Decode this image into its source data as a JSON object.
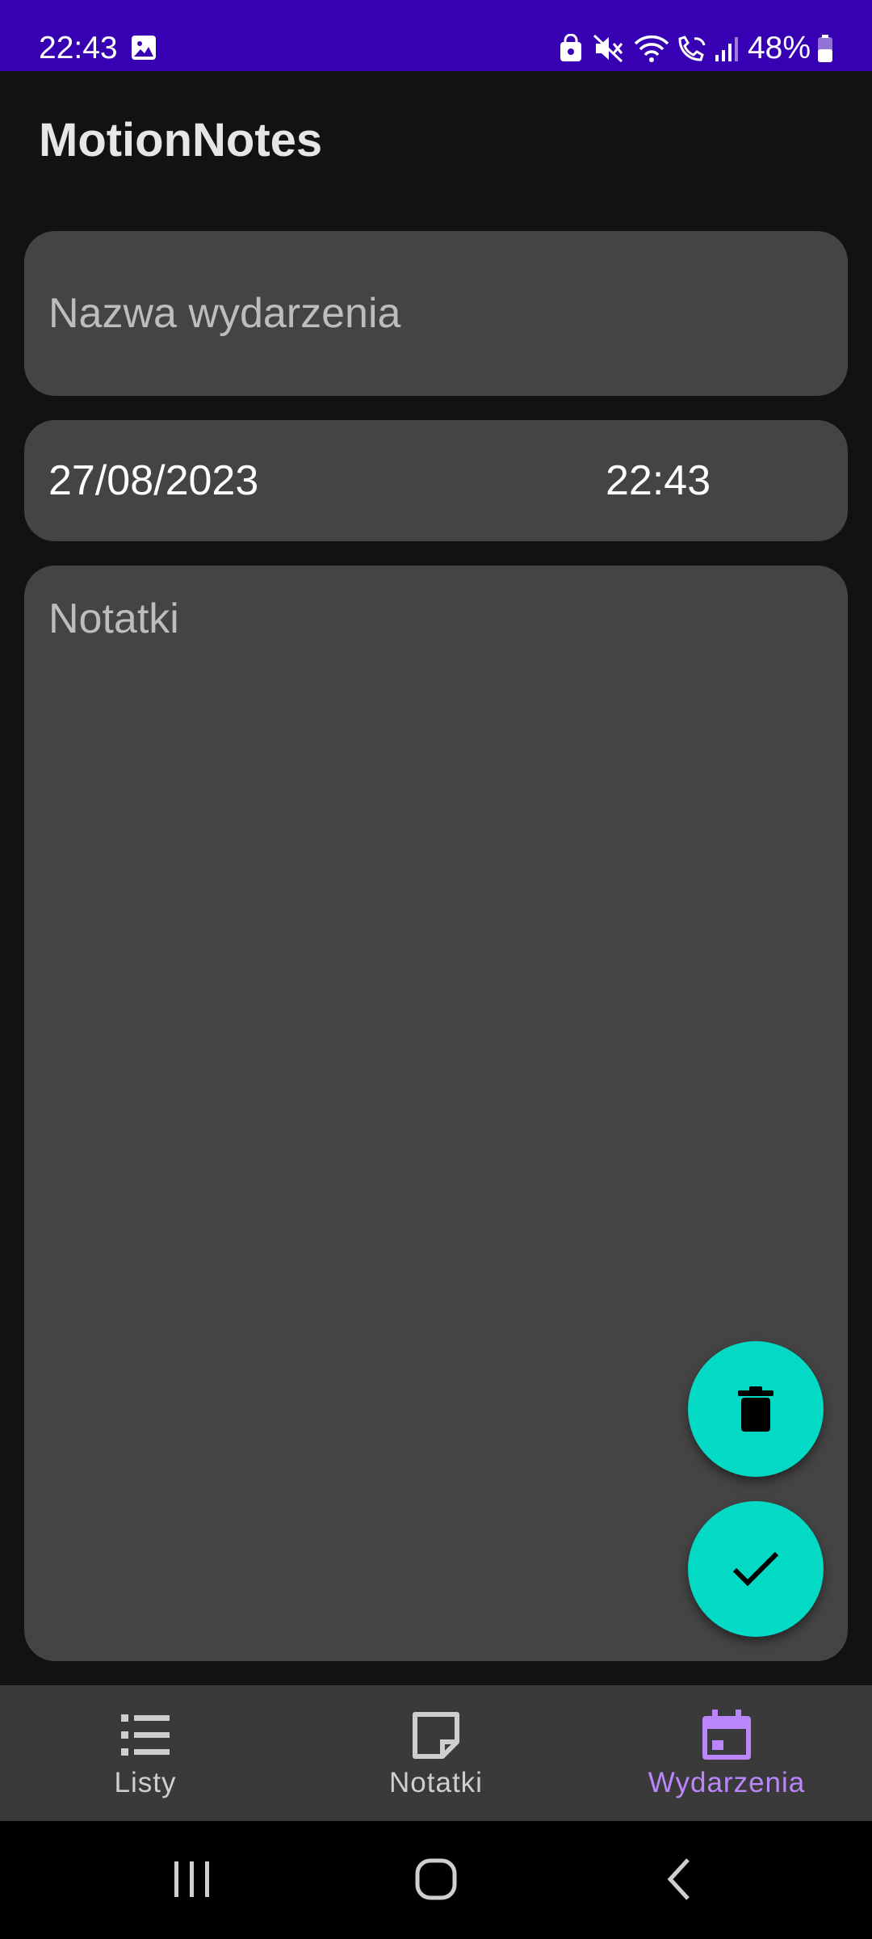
{
  "status_bar": {
    "time": "22:43",
    "battery": "48%",
    "background_color": "#3700b3",
    "icons": [
      "gallery-icon",
      "lock-icon",
      "mute-icon",
      "wifi-icon",
      "wifi-calling-icon",
      "signal-icon",
      "battery-icon"
    ]
  },
  "app": {
    "title": "MotionNotes"
  },
  "form": {
    "event_name_placeholder": "Nazwa wydarzenia",
    "date": "27/08/2023",
    "time": "22:43",
    "notes_placeholder": "Notatki"
  },
  "fabs": {
    "delete_icon": "trash-icon",
    "save_icon": "check-icon",
    "color": "#03dac5"
  },
  "bottom_nav": {
    "active": "events",
    "active_color": "#bb86fc",
    "items": [
      {
        "id": "lists",
        "label": "Listy",
        "icon": "list-icon"
      },
      {
        "id": "notes",
        "label": "Notatki",
        "icon": "note-icon"
      },
      {
        "id": "events",
        "label": "Wydarzenia",
        "icon": "calendar-icon"
      }
    ]
  },
  "system_nav": {
    "buttons": [
      "recents-icon",
      "home-icon",
      "back-icon"
    ]
  }
}
